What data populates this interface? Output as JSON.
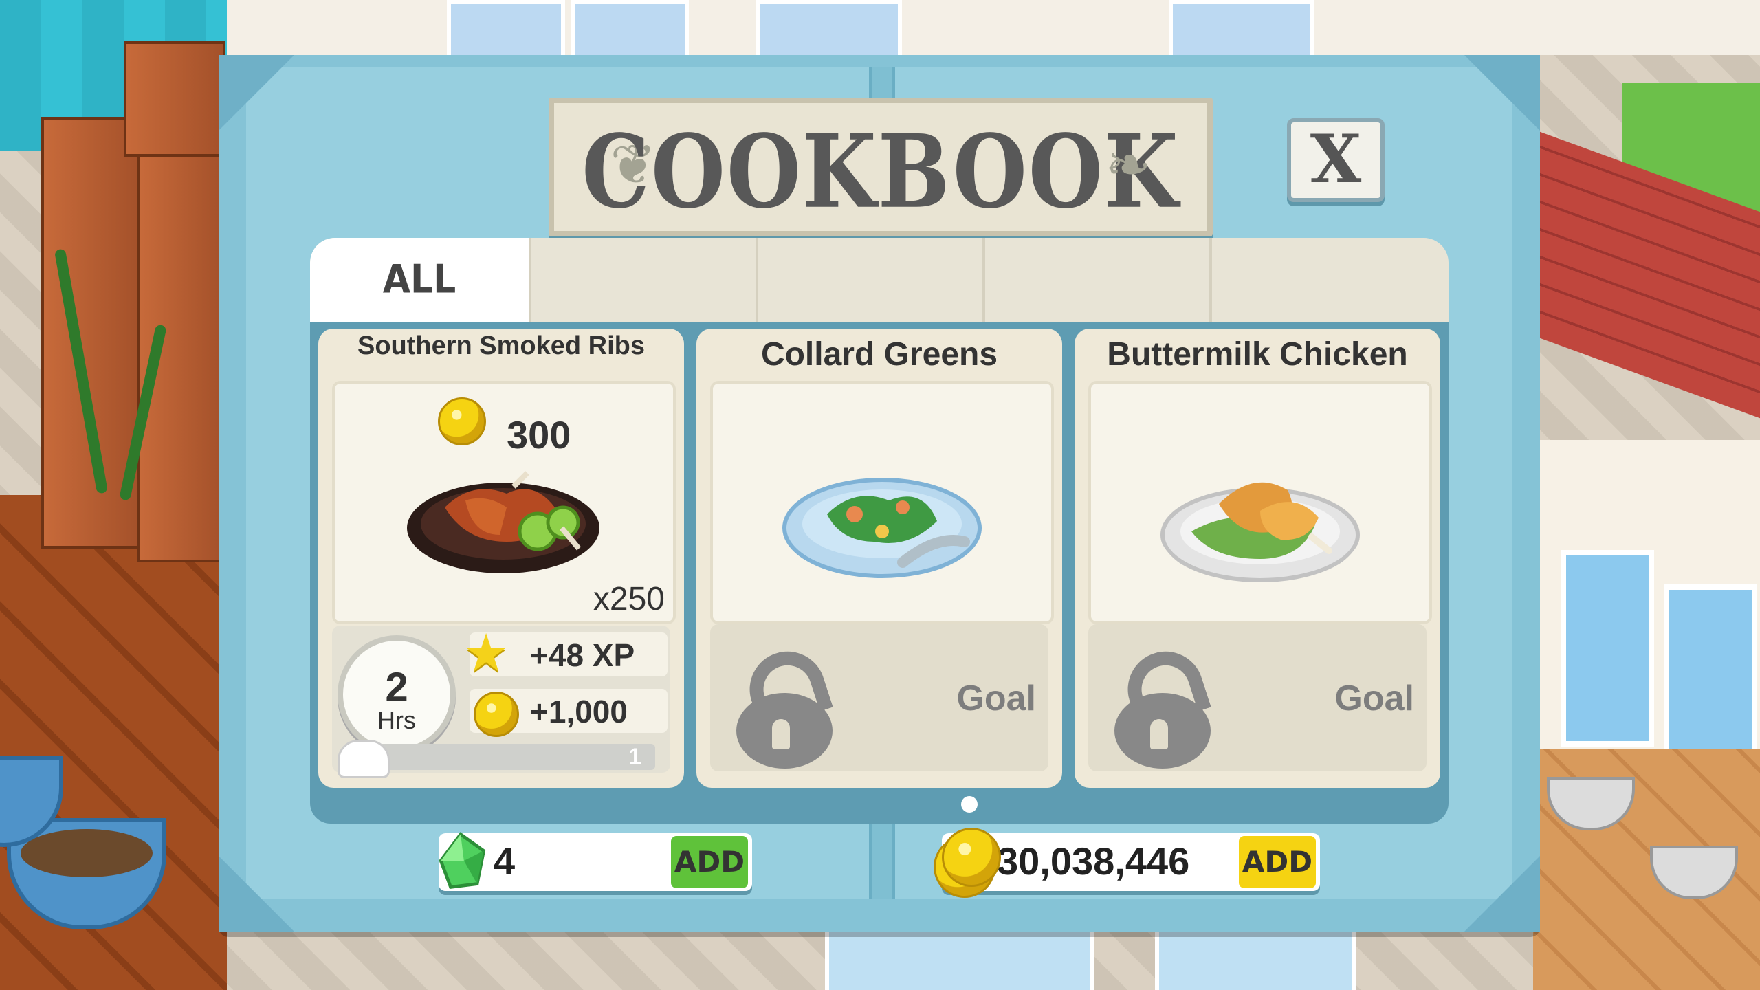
{
  "dialog": {
    "title": "COOKBOOK",
    "close_label": "X",
    "tabs": [
      {
        "label": "ALL",
        "active": true
      },
      {
        "label": ""
      },
      {
        "label": ""
      },
      {
        "label": ""
      },
      {
        "label": ""
      }
    ]
  },
  "recipes": [
    {
      "name": "Southern Smoked Ribs",
      "price": "300",
      "quantity": "x250",
      "time_value": "2",
      "time_unit": "Hrs",
      "xp_reward": "+48 XP",
      "coin_reward": "+1,000",
      "mastery_level": "1",
      "mastery_progress": 0.0,
      "locked": false
    },
    {
      "name": "Collard Greens",
      "locked": true,
      "lock_label": "Goal"
    },
    {
      "name": "Buttermilk Chicken",
      "locked": true,
      "lock_label": "Goal"
    }
  ],
  "pagination": {
    "current_page": 1,
    "total_pages": 1
  },
  "currency": {
    "gems": "4",
    "gems_add_label": "ADD",
    "coins": "30,038,446",
    "coins_add_label": "ADD"
  },
  "colors": {
    "dialog_frame": "#85c3d6",
    "gem_add_button": "#5fc23a",
    "coin_add_button": "#f5d312",
    "coin": "#f5d312",
    "lock": "#888888"
  },
  "icons": [
    "coin-icon",
    "gem-icon",
    "star-icon",
    "clock-icon",
    "lock-icon",
    "chef-hat-icon",
    "close-icon"
  ]
}
